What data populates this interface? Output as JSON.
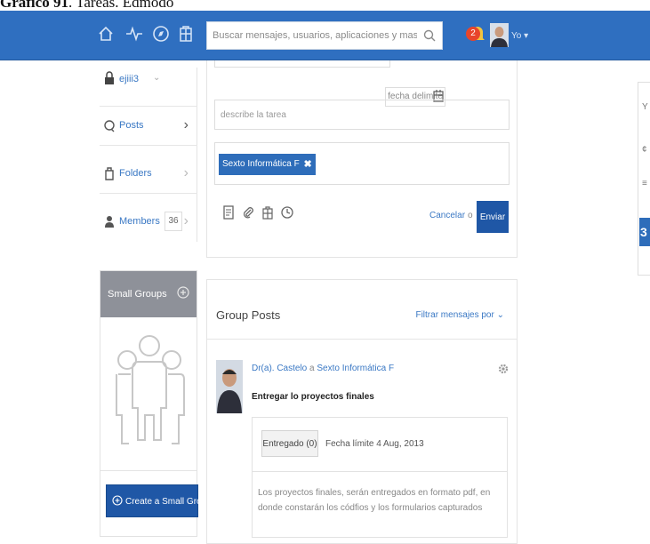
{
  "caption": {
    "label": "Gráfico 91",
    "text": ". Tareas. Edmodo"
  },
  "topbar": {
    "search_placeholder": "Buscar mensajes, usuarios, aplicaciones y mas...",
    "notification_count": "2",
    "user_label": "Yo ▾",
    "nav_icons": [
      "home-icon",
      "activity-icon",
      "compass-icon",
      "backpack-icon"
    ]
  },
  "sidebar": {
    "group_selector": "ejiii3",
    "posts": "Posts",
    "folders": "Folders",
    "members": "Members",
    "members_count": "36"
  },
  "small_groups": {
    "title": "Small Groups",
    "create_label": "Create a Small Group"
  },
  "task_form": {
    "date_placeholder": "fecha delimite",
    "description_placeholder": "describe la tarea",
    "recipient_tag": "Sexto Informática F",
    "cancel_label": "Cancelar",
    "or_label": "o",
    "send_label": "Enviar"
  },
  "group_posts": {
    "title": "Group Posts",
    "filter_label": "Filtrar mensajes por ⌄",
    "post": {
      "author": "Dr(a). Castelo",
      "connector": "a",
      "group": "Sexto Informática F",
      "title": "Entregar lo proyectos finales",
      "delivered_label": "Entregado (0)",
      "deadline": "Fecha límite 4 Aug, 2013",
      "body": "Los proyectos finales, serán entregados en formato pdf, en donde constarán los códfios y los formularios capturados"
    }
  },
  "right_panel": {
    "number": "3"
  },
  "colors": {
    "topbar": "#2f6fc0",
    "primary_button": "#1f57a6",
    "link": "#3a78c4",
    "badge": "#e8452b"
  }
}
